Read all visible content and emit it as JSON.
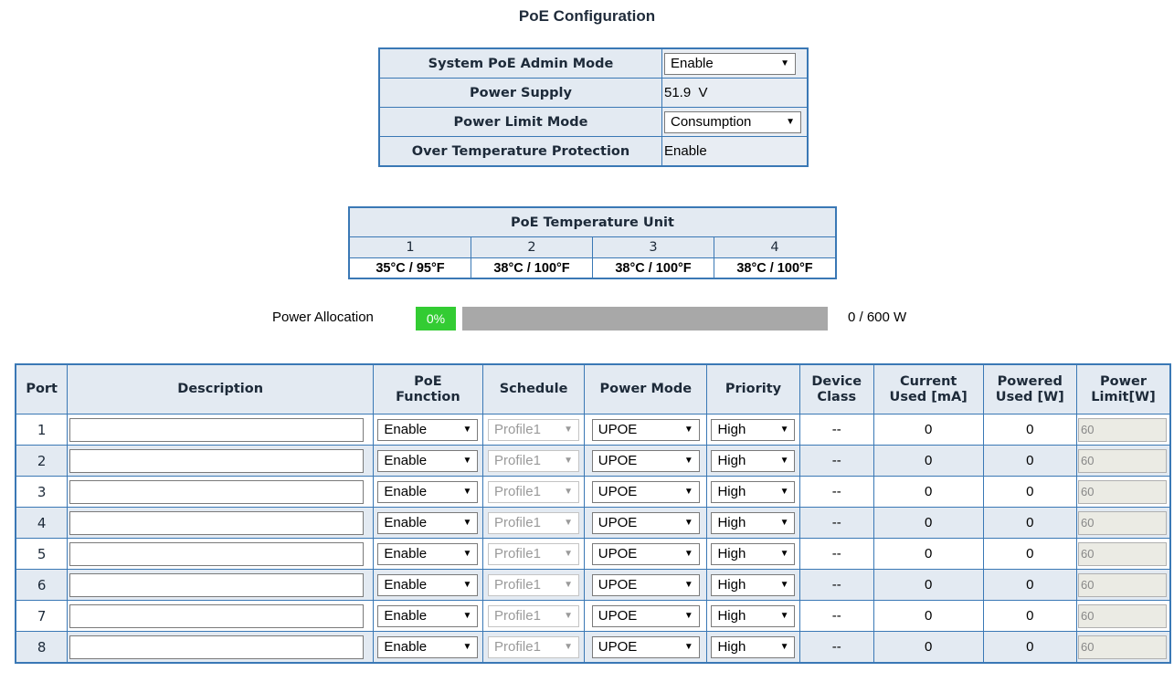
{
  "page": {
    "title": "PoE Configuration"
  },
  "system": {
    "admin_mode_label": "System PoE Admin Mode",
    "admin_mode_value": "Enable",
    "power_supply_label": "Power Supply",
    "power_supply_value": "51.9  V",
    "power_limit_label": "Power Limit Mode",
    "power_limit_value": "Consumption",
    "otp_label": "Over Temperature Protection",
    "otp_value": "Enable"
  },
  "temperature": {
    "title": "PoE Temperature Unit",
    "units": [
      "1",
      "2",
      "3",
      "4"
    ],
    "values": [
      "35°C / 95°F",
      "38°C / 100°F",
      "38°C / 100°F",
      "38°C / 100°F"
    ]
  },
  "allocation": {
    "label": "Power Allocation",
    "percent_text": "0%",
    "percent": 0,
    "value": "0 / 600 W",
    "colors": {
      "fill": "#33cc33",
      "track": "#a8a8a8"
    }
  },
  "ports": {
    "columns": [
      "Port",
      "Description",
      "PoE\nFunction",
      "Schedule",
      "Power Mode",
      "Priority",
      "Device\nClass",
      "Current\nUsed [mA]",
      "Powered\nUsed [W]",
      "Power\nLimit[W]"
    ],
    "rows": [
      {
        "port": "1",
        "description": "",
        "poe_function": "Enable",
        "schedule": "Profile1",
        "power_mode": "UPOE",
        "priority": "High",
        "device_class": "--",
        "current_ma": "0",
        "powered_w": "0",
        "limit_w": "60"
      },
      {
        "port": "2",
        "description": "",
        "poe_function": "Enable",
        "schedule": "Profile1",
        "power_mode": "UPOE",
        "priority": "High",
        "device_class": "--",
        "current_ma": "0",
        "powered_w": "0",
        "limit_w": "60"
      },
      {
        "port": "3",
        "description": "",
        "poe_function": "Enable",
        "schedule": "Profile1",
        "power_mode": "UPOE",
        "priority": "High",
        "device_class": "--",
        "current_ma": "0",
        "powered_w": "0",
        "limit_w": "60"
      },
      {
        "port": "4",
        "description": "",
        "poe_function": "Enable",
        "schedule": "Profile1",
        "power_mode": "UPOE",
        "priority": "High",
        "device_class": "--",
        "current_ma": "0",
        "powered_w": "0",
        "limit_w": "60"
      },
      {
        "port": "5",
        "description": "",
        "poe_function": "Enable",
        "schedule": "Profile1",
        "power_mode": "UPOE",
        "priority": "High",
        "device_class": "--",
        "current_ma": "0",
        "powered_w": "0",
        "limit_w": "60"
      },
      {
        "port": "6",
        "description": "",
        "poe_function": "Enable",
        "schedule": "Profile1",
        "power_mode": "UPOE",
        "priority": "High",
        "device_class": "--",
        "current_ma": "0",
        "powered_w": "0",
        "limit_w": "60"
      },
      {
        "port": "7",
        "description": "",
        "poe_function": "Enable",
        "schedule": "Profile1",
        "power_mode": "UPOE",
        "priority": "High",
        "device_class": "--",
        "current_ma": "0",
        "powered_w": "0",
        "limit_w": "60"
      },
      {
        "port": "8",
        "description": "",
        "poe_function": "Enable",
        "schedule": "Profile1",
        "power_mode": "UPOE",
        "priority": "High",
        "device_class": "--",
        "current_ma": "0",
        "powered_w": "0",
        "limit_w": "60"
      }
    ]
  },
  "icons": {
    "dropdown": "chevron-down-icon"
  },
  "colors": {
    "border": "#3a78b5",
    "header_bg": "#e3eaf2",
    "title": "#1f2b3a"
  }
}
